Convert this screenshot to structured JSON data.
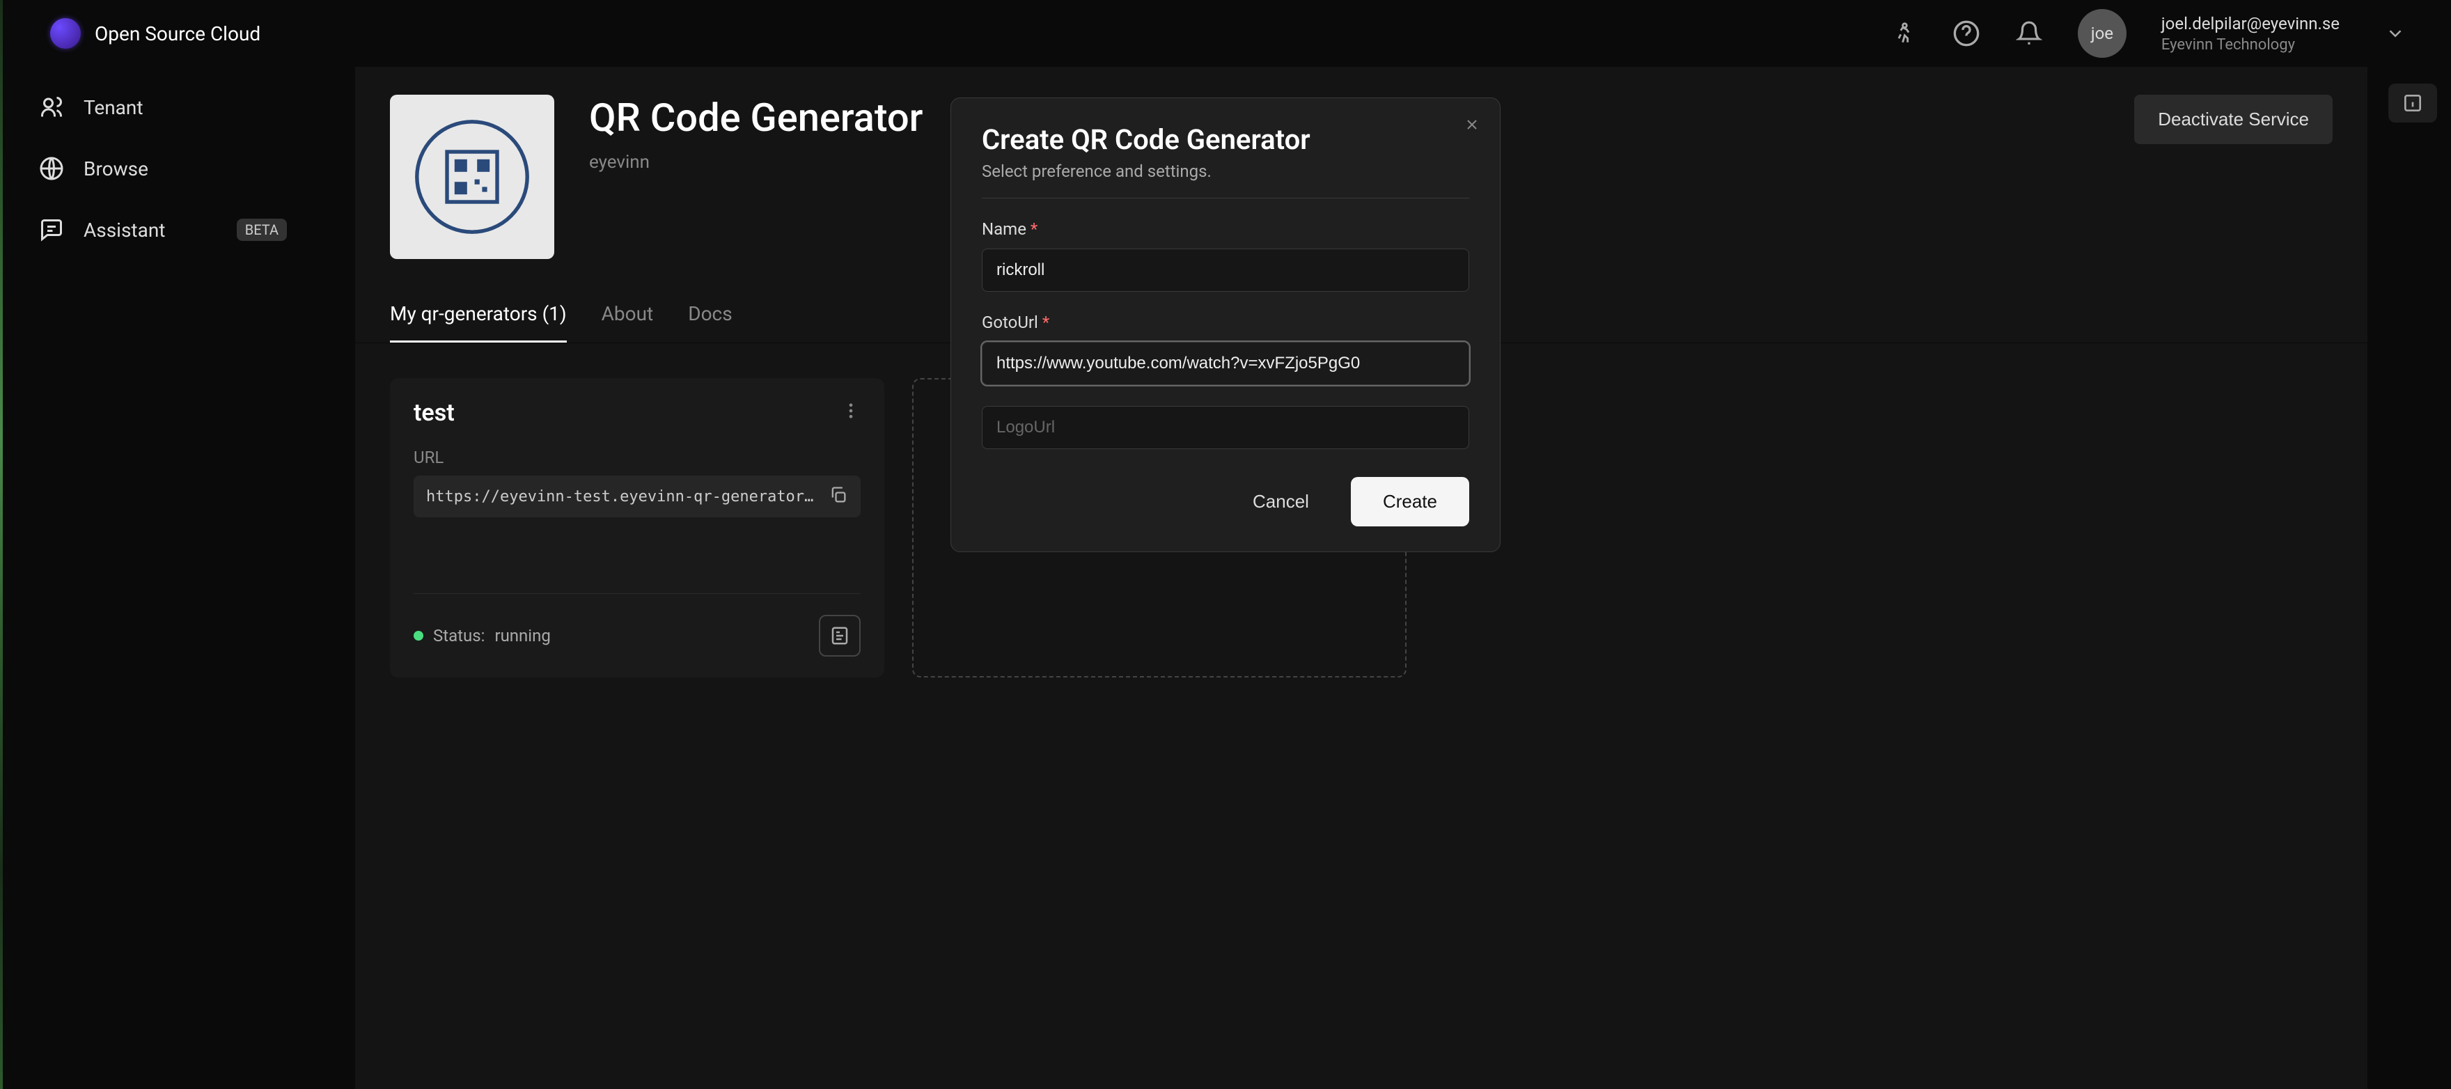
{
  "brand": "Open Source Cloud",
  "user": {
    "avatar_initials": "joe",
    "email": "joel.delpilar@eyevinn.se",
    "org": "Eyevinn Technology"
  },
  "sidebar": {
    "items": [
      {
        "label": "Tenant"
      },
      {
        "label": "Browse"
      },
      {
        "label": "Assistant",
        "badge": "BETA"
      }
    ]
  },
  "page": {
    "title": "QR Code Generator",
    "subtitle": "eyevinn",
    "deactivate_label": "Deactivate Service"
  },
  "tabs": [
    {
      "label": "My qr-generators (1)",
      "active": true
    },
    {
      "label": "About",
      "active": false
    },
    {
      "label": "Docs",
      "active": false
    }
  ],
  "card": {
    "title": "test",
    "url_label": "URL",
    "url_value": "https://eyevinn-test.eyevinn-qr-generator.a…",
    "status_label": "Status:",
    "status_value": "running"
  },
  "modal": {
    "title": "Create QR Code Generator",
    "subtitle": "Select preference and settings.",
    "name_label": "Name",
    "name_value": "rickroll",
    "gotourl_label": "GotoUrl",
    "gotourl_value": "https://www.youtube.com/watch?v=xvFZjo5PgG0",
    "logourl_placeholder": "LogoUrl",
    "cancel_label": "Cancel",
    "create_label": "Create"
  }
}
